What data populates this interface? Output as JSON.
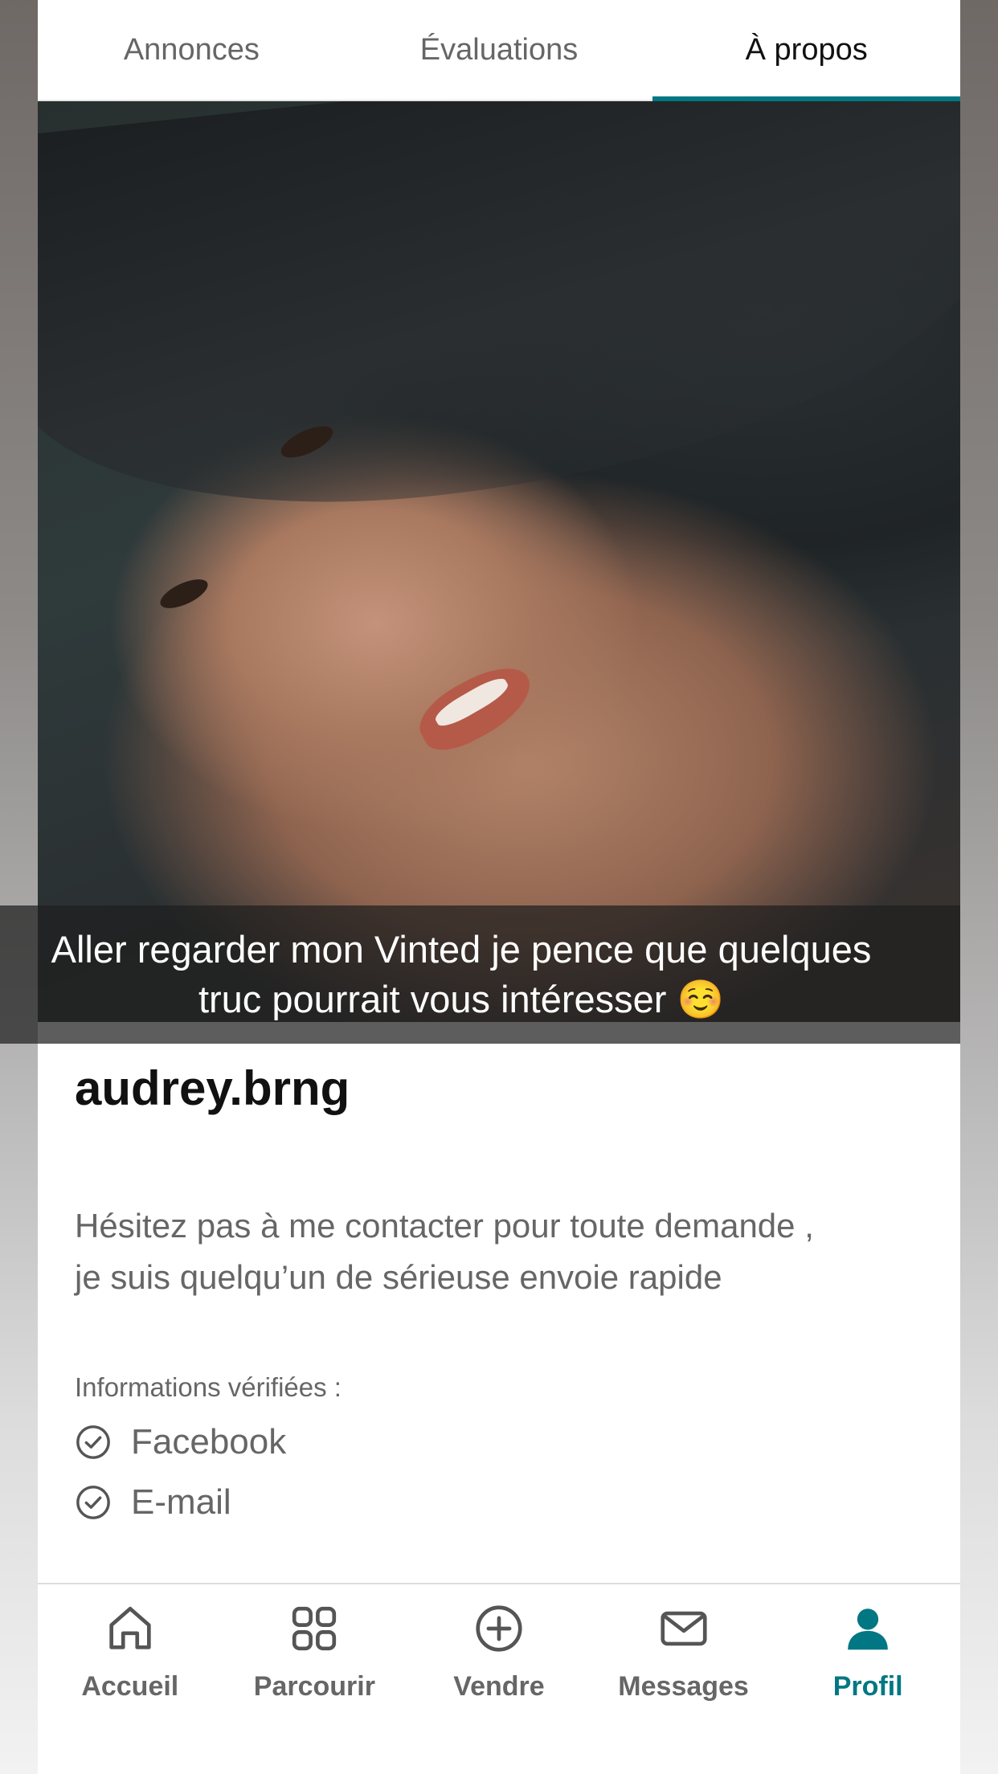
{
  "tabs": [
    {
      "label": "Annonces",
      "active": false
    },
    {
      "label": "Évaluations",
      "active": false
    },
    {
      "label": "À propos",
      "active": true
    }
  ],
  "caption": {
    "line1": "Aller regarder mon Vinted je pence que quelques",
    "line2": "truc pourrait vous intéresser ☺️"
  },
  "profile": {
    "username": "audrey.brng",
    "bio_line1": "Hésitez pas à me contacter pour toute demande ,",
    "bio_line2": "je suis quelqu’un de sérieuse envoie rapide",
    "verified_title": "Informations vérifiées :",
    "verified": [
      "Facebook",
      "E-mail"
    ]
  },
  "bottom_nav": [
    {
      "label": "Accueil",
      "icon": "home-icon"
    },
    {
      "label": "Parcourir",
      "icon": "grid-icon"
    },
    {
      "label": "Vendre",
      "icon": "plus-circle-icon"
    },
    {
      "label": "Messages",
      "icon": "envelope-icon"
    },
    {
      "label": "Profil",
      "icon": "person-icon",
      "active": true
    }
  ],
  "colors": {
    "accent": "#007782",
    "text_primary": "#111111",
    "text_secondary": "#666666"
  }
}
